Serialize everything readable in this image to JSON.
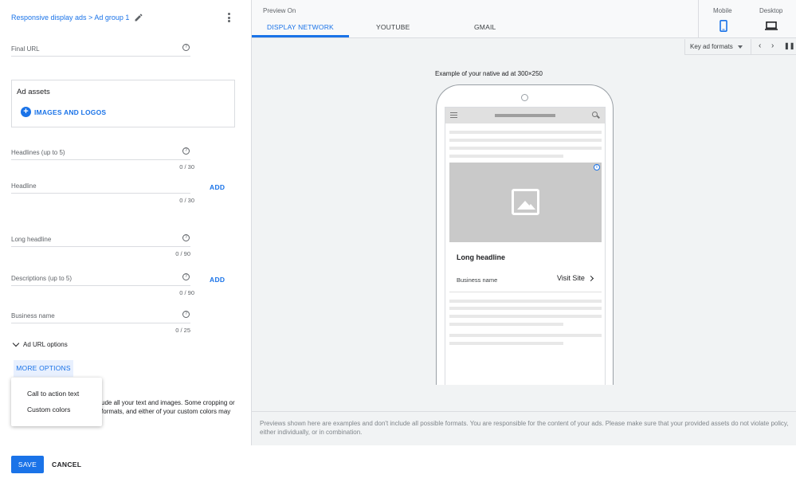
{
  "breadcrumb": "Responsive display ads > Ad group 1",
  "form": {
    "final_url": {
      "label": "Final URL"
    },
    "ad_assets": {
      "title": "Ad assets",
      "images_button": "IMAGES AND LOGOS"
    },
    "headlines": {
      "label": "Headlines (up to 5)",
      "counter": "0 / 30"
    },
    "headline": {
      "label": "Headline",
      "counter": "0 / 30",
      "add": "ADD"
    },
    "long_headline": {
      "label": "Long headline",
      "counter": "0 / 90"
    },
    "descriptions": {
      "label": "Descriptions (up to 5)",
      "counter": "0 / 90",
      "add": "ADD"
    },
    "business_name": {
      "label": "Business name",
      "counter": "0 / 25"
    },
    "ad_url_options": "Ad URL options",
    "more_options": "MORE OPTIONS",
    "more_menu": [
      "Call to action text",
      "Custom colors"
    ],
    "partial_text": [
      "ude all your text and images. Some cropping or",
      "formats, and either of your custom colors may"
    ],
    "save": "SAVE",
    "cancel": "CANCEL"
  },
  "preview": {
    "preview_on": "Preview On",
    "tabs": [
      "DISPLAY NETWORK",
      "YOUTUBE",
      "GMAIL"
    ],
    "active_tab": "DISPLAY NETWORK",
    "devices": [
      "Mobile",
      "Desktop"
    ],
    "active_device": "Mobile",
    "format_select": "Key ad formats",
    "example_caption": "Example of your native ad at 300×250",
    "ad": {
      "headline": "Long headline",
      "business_name": "Business name",
      "cta": "Visit Site"
    },
    "disclaimer": "Previews shown here are examples and don't include all possible formats. You are responsible for the content of your ads. Please make sure that your provided assets do not violate policy, either individually, or in combination."
  },
  "colors": {
    "accent": "#1a73e8",
    "panel_bg": "#f1f3f4",
    "placeholder": "#c9c9c9"
  }
}
